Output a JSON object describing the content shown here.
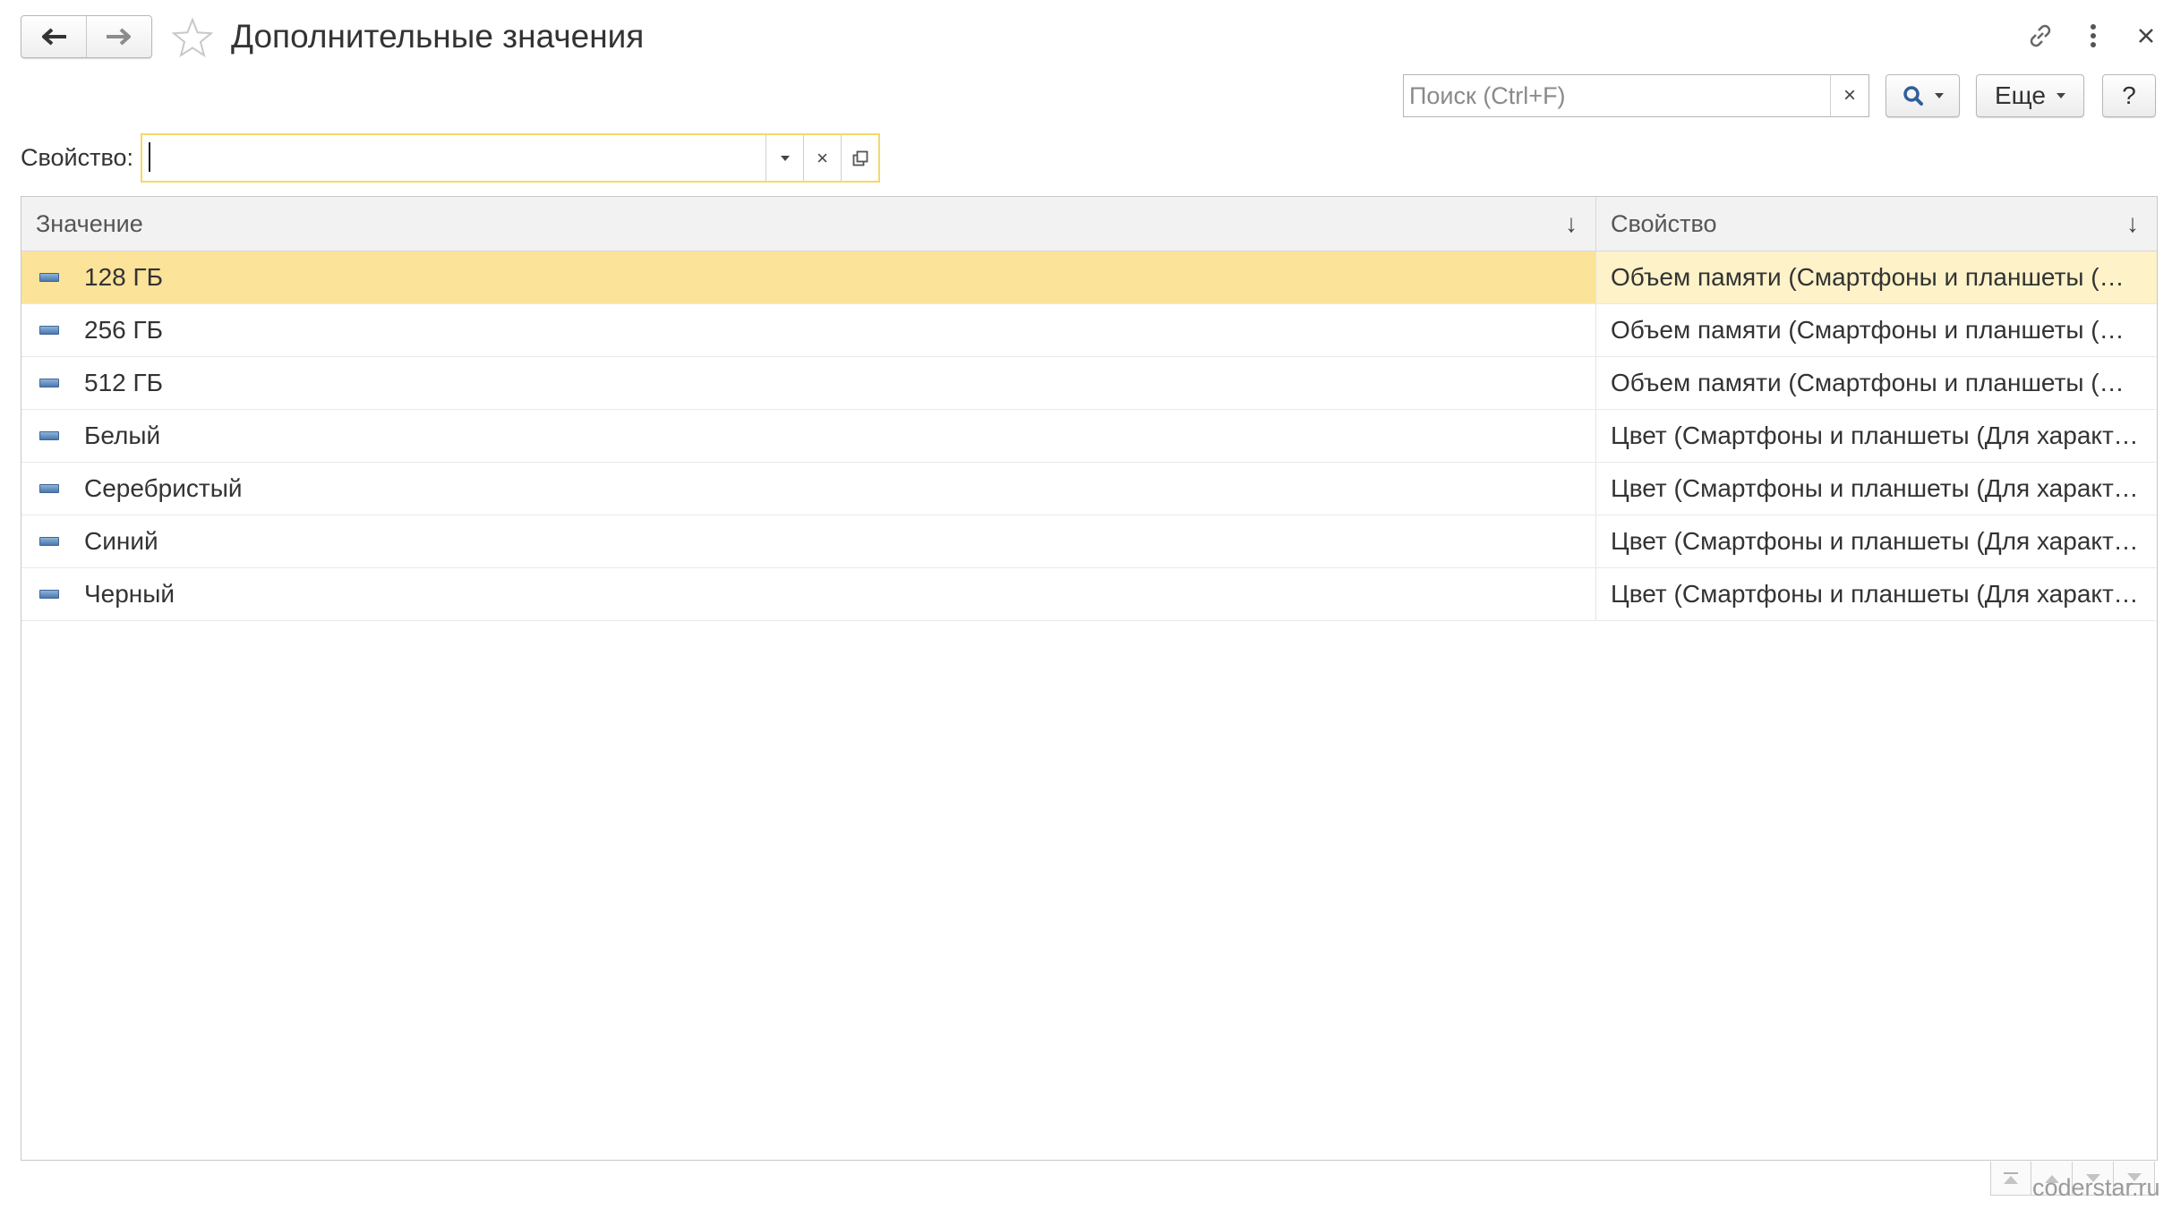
{
  "header": {
    "title": "Дополнительные значения",
    "icons": [
      "arrow-left-icon",
      "arrow-right-icon",
      "star-icon",
      "link-icon",
      "more-vertical-icon",
      "close-icon"
    ]
  },
  "toolbar": {
    "search_placeholder": "Поиск (Ctrl+F)",
    "search_value": "",
    "clear_label": "×",
    "more_label": "Еще",
    "help_label": "?"
  },
  "filter": {
    "label": "Свойство:",
    "value": "",
    "clear_label": "×"
  },
  "table": {
    "columns": [
      {
        "label": "Значение",
        "sort": "↓"
      },
      {
        "label": "Свойство",
        "sort": "↓"
      }
    ],
    "rows": [
      {
        "value": "128 ГБ",
        "property": "Объем памяти (Смартфоны и планшеты (Для характеристик))",
        "selected": true
      },
      {
        "value": "256 ГБ",
        "property": "Объем памяти (Смартфоны и планшеты (Для характеристик))"
      },
      {
        "value": "512 ГБ",
        "property": "Объем памяти (Смартфоны и планшеты (Для характеристик))"
      },
      {
        "value": "Белый",
        "property": "Цвет (Смартфоны и планшеты (Для характеристик))"
      },
      {
        "value": "Серебристый",
        "property": "Цвет (Смартфоны и планшеты (Для характеристик))"
      },
      {
        "value": "Синий",
        "property": "Цвет (Смартфоны и планшеты (Для характеристик))"
      },
      {
        "value": "Черный",
        "property": "Цвет (Смартфоны и планшеты (Для характеристик))"
      }
    ]
  },
  "colors": {
    "selected_row": "#fbe39a",
    "focus_border": "#f5d86a",
    "item_icon": "#4a78b0"
  },
  "watermark": "coderstar.ru"
}
